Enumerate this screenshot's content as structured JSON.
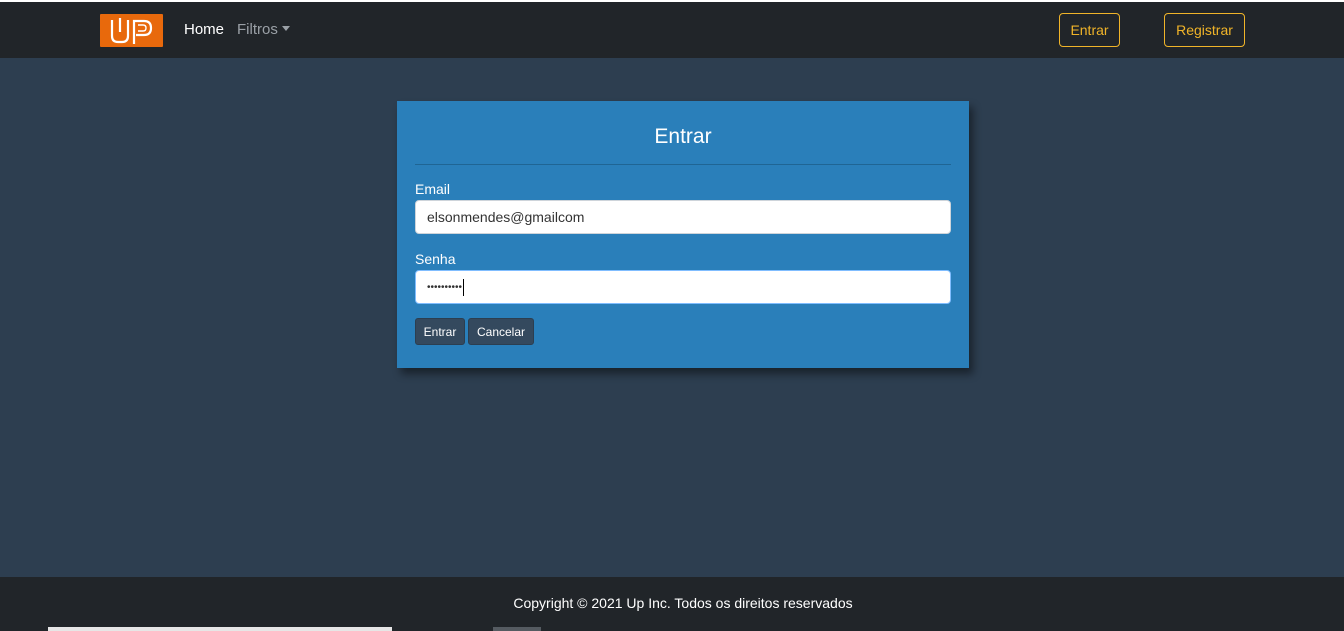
{
  "navbar": {
    "logo_text": "UP",
    "home_label": "Home",
    "filtros_label": "Filtros",
    "entrar_label": "Entrar",
    "registrar_label": "Registrar"
  },
  "login_card": {
    "title": "Entrar",
    "email_label": "Email",
    "email_value": "elsonmendes@gmailcom",
    "senha_label": "Senha",
    "senha_value": "••••••••••",
    "submit_label": "Entrar",
    "cancel_label": "Cancelar"
  },
  "footer": {
    "copyright": "Copyright © 2021 Up Inc. Todos os direitos reservados"
  },
  "colors": {
    "navbar_bg": "#212529",
    "page_bg": "#2d3e50",
    "card_bg": "#2a7fba",
    "accent_outline": "#f0b429",
    "logo_bg": "#e8690c"
  }
}
